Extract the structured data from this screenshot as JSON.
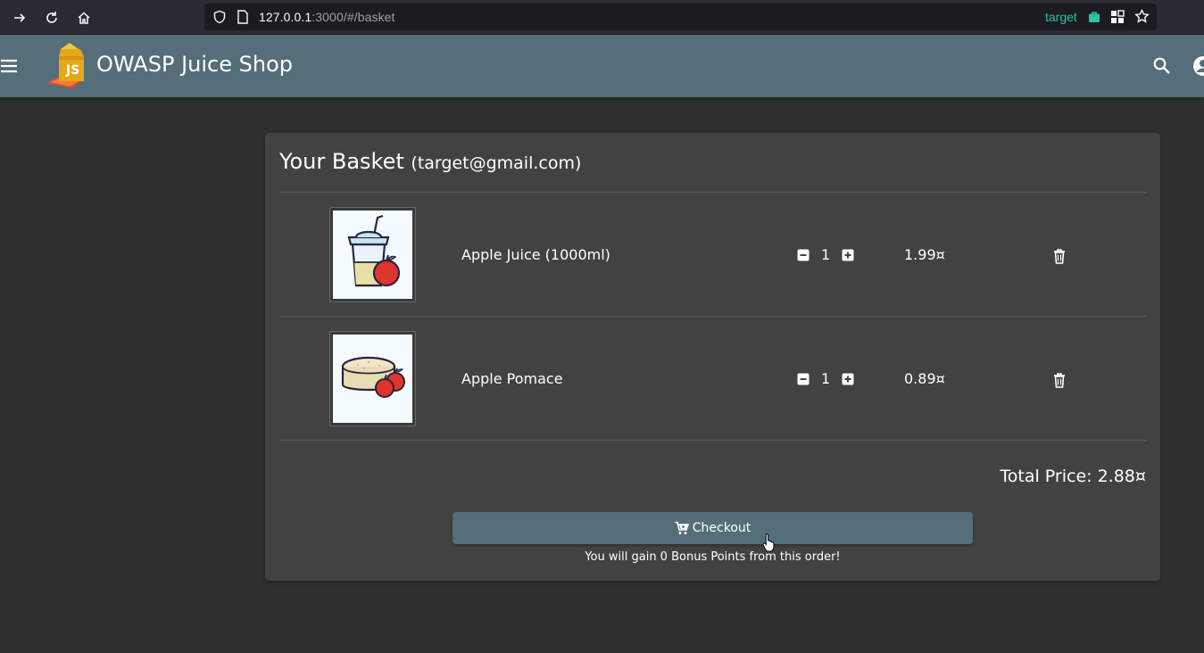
{
  "browser": {
    "url_host": "127.0.0.1",
    "url_rest": ":3000/#/basket",
    "container_label": "target"
  },
  "app": {
    "title": "OWASP Juice Shop"
  },
  "basket": {
    "title": "Your Basket",
    "email": "(target@gmail.com)",
    "items": [
      {
        "name": "Apple Juice (1000ml)",
        "quantity": "1",
        "price": "1.99¤"
      },
      {
        "name": "Apple Pomace",
        "quantity": "1",
        "price": "0.89¤"
      }
    ],
    "total": "Total Price: 2.88¤",
    "checkout_label": "Checkout",
    "bonus_text": "You will gain 0 Bonus Points from this order!"
  },
  "colors": {
    "toolbar": "#546e7a",
    "card": "#424242",
    "background": "#303030",
    "container_accent": "#2ac3a2"
  }
}
